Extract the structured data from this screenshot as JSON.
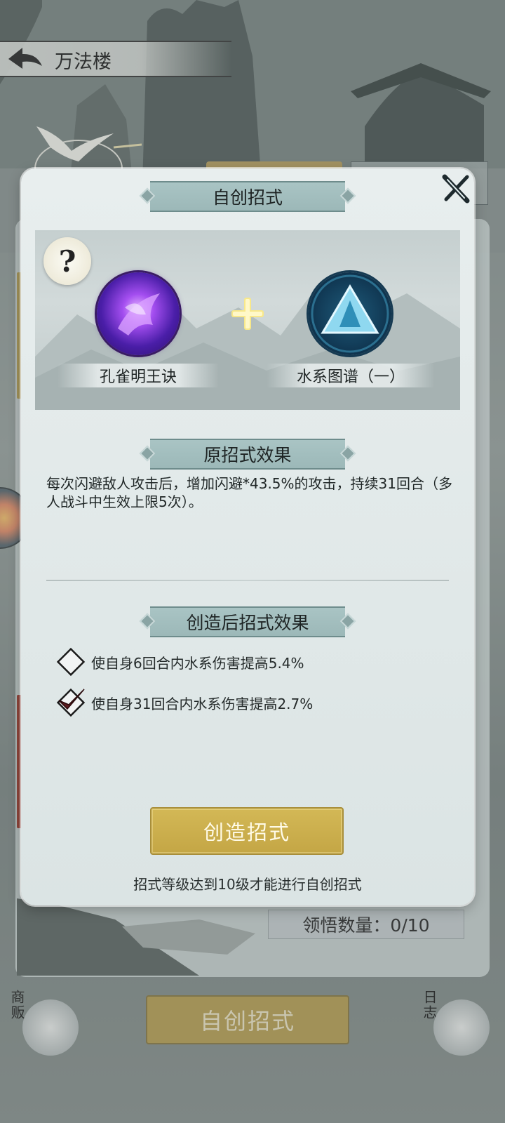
{
  "top_bar": {
    "title": "万法楼"
  },
  "background": {
    "count_label": "领悟数量：0/10",
    "bottom_button": "自创招式",
    "merchant_label": "商贩",
    "log_label": "日志"
  },
  "modal": {
    "title": "自创招式",
    "skills": [
      {
        "name": "孔雀明王诀"
      },
      {
        "name": "水系图谱（一）"
      }
    ],
    "original_section_title": "原招式效果",
    "original_effect": "每次闪避敌人攻击后，增加闪避*43.5%的攻击，持续31回合（多人战斗中生效上限5次）。",
    "created_section_title": "创造后招式效果",
    "options": [
      {
        "text": "使自身6回合内水系伤害提高5.4%",
        "checked": false
      },
      {
        "text": "使自身31回合内水系伤害提高2.7%",
        "checked": true
      }
    ],
    "create_button": "创造招式",
    "hint": "招式等级达到10级才能进行自创招式",
    "help_symbol": "?"
  },
  "colors": {
    "gold_button": "#c4a645",
    "ribbon": "#a9c4c4",
    "modal_bg": "#e8eeee"
  }
}
